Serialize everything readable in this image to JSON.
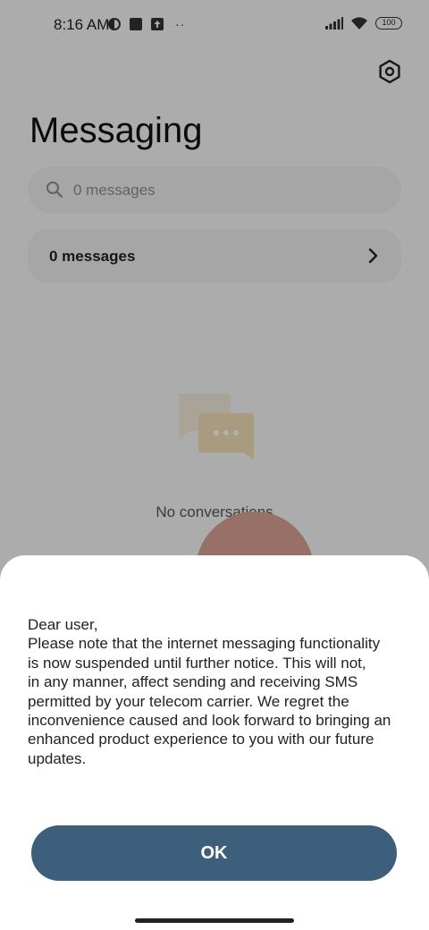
{
  "status_bar": {
    "time": "8:16 AM",
    "notification_icons": [
      "vpn-icon",
      "square-app-icon",
      "upload-icon"
    ],
    "overflow": "··",
    "battery_level": "100",
    "right_icons": [
      "signal-icon",
      "wifi-icon",
      "battery-icon"
    ]
  },
  "header": {
    "title": "Messaging",
    "settings_icon": "settings-icon"
  },
  "search": {
    "placeholder": "0 messages",
    "icon": "search-icon"
  },
  "messages_row": {
    "label": "0 messages"
  },
  "empty_state": {
    "text": "No conversations"
  },
  "dialog": {
    "message": "Dear user,\nPlease note that the internet messaging functionality\nis now suspended until further notice. This will not,\nin any manner, affect sending and receiving SMS\npermitted by your telecom carrier. We regret the\ninconvenience caused and look forward to bringing an\nenhanced product experience to you with our future\nupdates.",
    "ok_label": "OK"
  },
  "colors": {
    "ok_button": "#3d5f7b",
    "fab": "#d9a194",
    "overlay": "rgba(0,0,0,0.30)"
  }
}
